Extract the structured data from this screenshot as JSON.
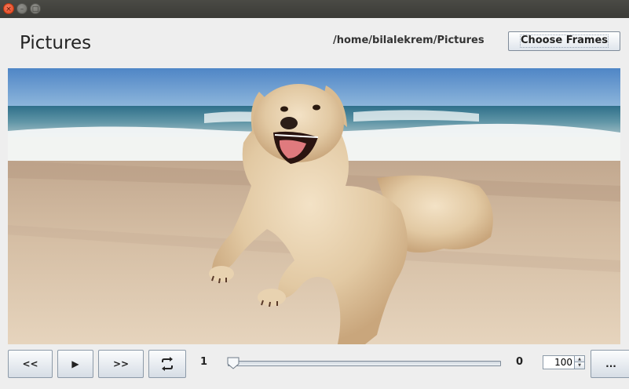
{
  "window": {
    "close_glyph": "×",
    "minimize_glyph": "–",
    "maximize_glyph": "□"
  },
  "header": {
    "title": "Pictures",
    "path": "/home/bilalekrem/Pictures",
    "choose_frames_label": "Choose Frames"
  },
  "viewer": {
    "image_description_icon": "dog-on-beach-photo"
  },
  "controls": {
    "rewind_label": "<<",
    "play_label": "▶",
    "forward_label": ">>",
    "loop_icon": "loop-icon",
    "current_frame": "1",
    "total_frames": "0",
    "slider_value": 0,
    "speed_value": "100",
    "more_label": "..."
  },
  "colors": {
    "titlebar": "#3b3b37",
    "close_button": "#e2431e",
    "background": "#eeeeee"
  }
}
